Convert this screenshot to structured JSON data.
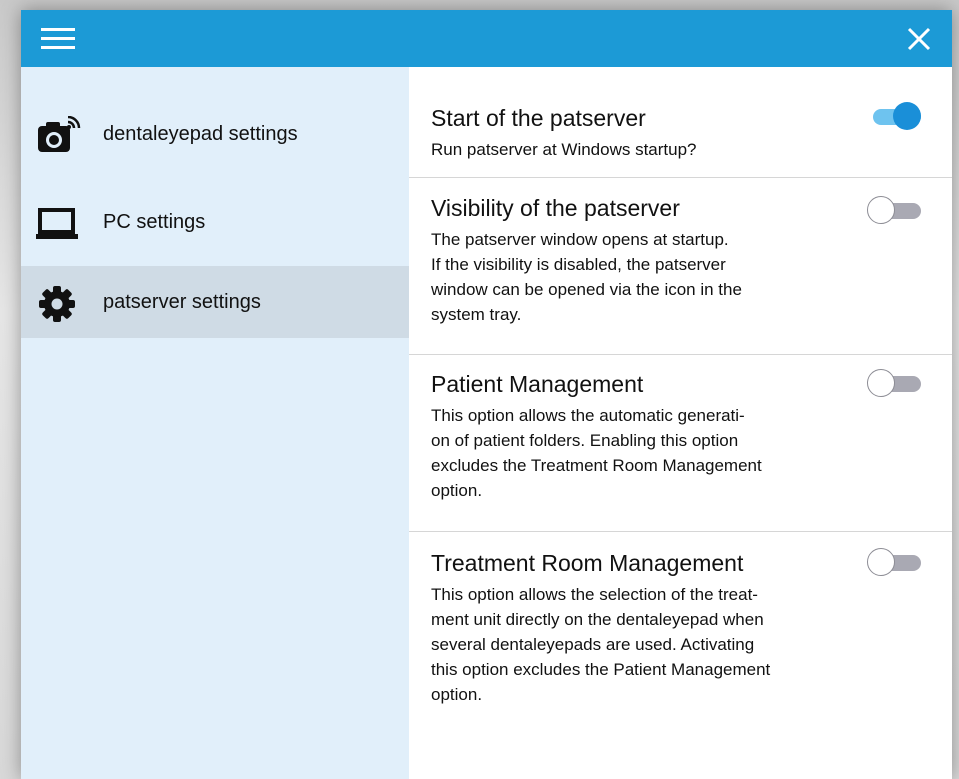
{
  "titlebar": {
    "menu_icon": "hamburger-menu-icon",
    "close_icon": "close-icon"
  },
  "sidebar": {
    "items": [
      {
        "label": "dentaleyepad settings",
        "icon": "camera-wireless-icon",
        "active": false
      },
      {
        "label": "PC settings",
        "icon": "laptop-icon",
        "active": false
      },
      {
        "label": "patserver settings",
        "icon": "gear-icon",
        "active": true
      }
    ]
  },
  "settings": [
    {
      "title": "Start of the patserver",
      "description": "Run patserver at Windows startup?",
      "enabled": true
    },
    {
      "title": "Visibility of the patserver",
      "description": "The patserver window opens at startup.\nIf the visibility is disabled, the patserver\nwindow can be opened via the icon in the\nsystem tray.",
      "enabled": false
    },
    {
      "title": "Patient Management",
      "description": "This option allows the automatic generati-\non of patient folders. Enabling this option\nexcludes the Treatment Room Management\noption.",
      "enabled": false
    },
    {
      "title": "Treatment Room Management",
      "description": "This option allows the selection of the treat-\nment unit directly on the dentaleyepad when\nseveral dentaleyepads are used. Activating\nthis option excludes the Patient Management\noption.",
      "enabled": false
    }
  ],
  "colors": {
    "titlebar": "#1c9ad6",
    "sidebar": "#e1effa",
    "sidebar_active": "#cfdbe5",
    "toggle_on": "#1a8fd8"
  }
}
